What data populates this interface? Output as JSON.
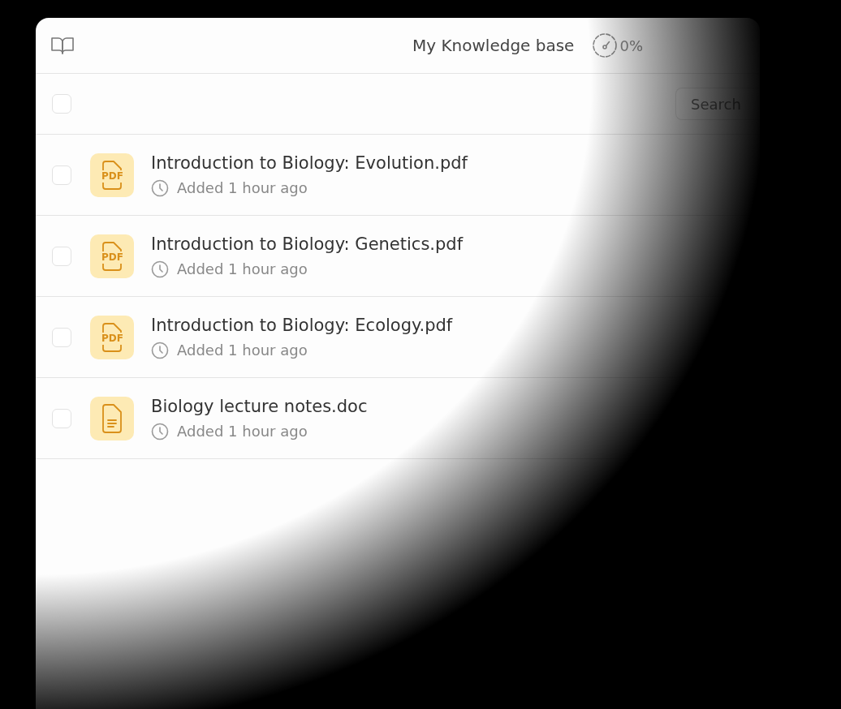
{
  "header": {
    "title": "My Knowledge base",
    "usage": "0%"
  },
  "toolbar": {
    "select_all": {
      "checked": false
    },
    "search": {
      "placeholder": "Search"
    }
  },
  "files": [
    {
      "name": "Introduction to Biology: Evolution.pdf",
      "kind": "pdf",
      "badge": "PDF",
      "added": "Added 1 hour ago",
      "checked": false
    },
    {
      "name": "Introduction to Biology: Genetics.pdf",
      "kind": "pdf",
      "badge": "PDF",
      "added": "Added 1 hour ago",
      "checked": false
    },
    {
      "name": "Introduction to Biology: Ecology.pdf",
      "kind": "pdf",
      "badge": "PDF",
      "added": "Added 1 hour ago",
      "checked": false
    },
    {
      "name": "Biology lecture notes.doc",
      "kind": "doc",
      "added": "Added 1 hour ago",
      "checked": false
    }
  ]
}
